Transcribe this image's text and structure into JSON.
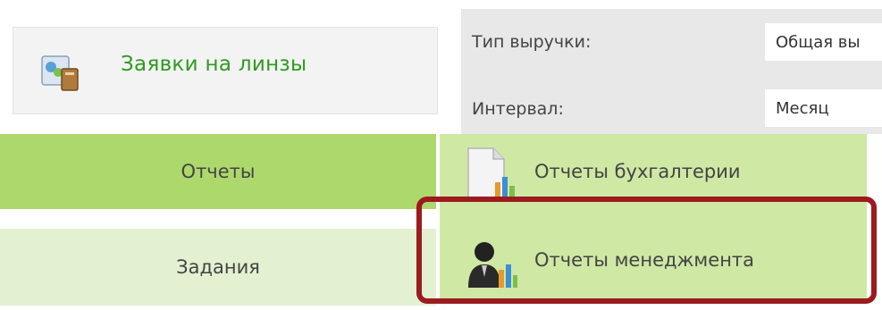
{
  "sidebar": {
    "lens_requests_label": "Заявки на линзы",
    "items": [
      {
        "label": "Отчеты"
      },
      {
        "label": "Задания"
      }
    ]
  },
  "filters": {
    "revenue_type_label": "Тип выручки:",
    "revenue_type_value": "Общая вы",
    "interval_label": "Интервал:",
    "interval_value": "Месяц"
  },
  "submenu": {
    "items": [
      {
        "label": "Отчеты бухгалтерии",
        "icon": "accounting-report-icon"
      },
      {
        "label": "Отчеты менеджмента",
        "icon": "management-report-icon"
      }
    ]
  },
  "colors": {
    "active_menu": "#add86c",
    "inactive_menu": "#e3f1d1",
    "submenu": "#cfe8a4",
    "highlight": "#9b1b1e",
    "lens_link": "#2f9a20"
  }
}
